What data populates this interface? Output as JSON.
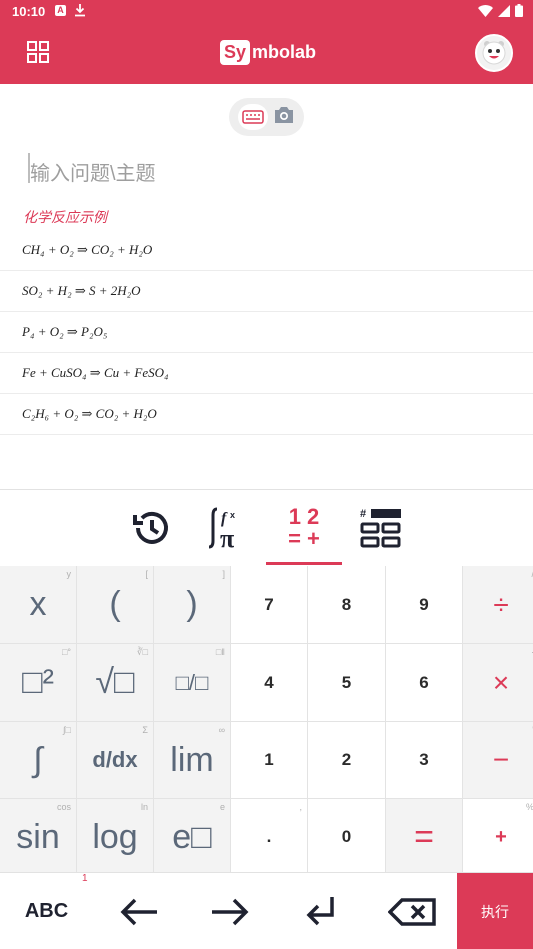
{
  "status_bar": {
    "time": "10:10",
    "notif_letter": "A"
  },
  "header": {
    "logo_highlight": "Sy",
    "logo_rest": "mbolab"
  },
  "input": {
    "placeholder": "输入问题\\主题"
  },
  "examples": {
    "title": "化学反应示例",
    "items": [
      "CH₄ + O₂ ⇒ CO₂ + H₂O",
      "SO₂ + H₂ ⇒ S + 2H₂O",
      "P₄ + O₂ ⇒ P₂O₅",
      "Fe + CuSO₄ ⇒ Cu + FeSO₄",
      "C₂H₆ + O₂ ⇒ CO₂ + H₂O"
    ]
  },
  "keyboard_tabs": {
    "numbers_top": "1 2",
    "numbers_bottom": "= +"
  },
  "keypad": {
    "row1": [
      {
        "label": "x",
        "hint": "y"
      },
      {
        "label": "(",
        "hint": "["
      },
      {
        "label": ")",
        "hint": "]"
      },
      {
        "label": "7",
        "hint": ""
      },
      {
        "label": "8",
        "hint": ""
      },
      {
        "label": "9",
        "hint": ""
      },
      {
        "label": "÷",
        "hint": "/"
      }
    ],
    "row2": [
      {
        "label": "□²",
        "hint": "□°"
      },
      {
        "label": "√□",
        "hint": "∛□"
      },
      {
        "label": "□/□",
        "hint": "□‖"
      },
      {
        "label": "4",
        "hint": ""
      },
      {
        "label": "5",
        "hint": ""
      },
      {
        "label": "6",
        "hint": ""
      },
      {
        "label": "×",
        "hint": "·"
      }
    ],
    "row3": [
      {
        "label": "∫",
        "hint": "∫□"
      },
      {
        "label": "d/dx",
        "hint": "Σ"
      },
      {
        "label": "lim",
        "hint": "∞"
      },
      {
        "label": "1",
        "hint": ""
      },
      {
        "label": "2",
        "hint": ""
      },
      {
        "label": "3",
        "hint": ""
      },
      {
        "label": "−",
        "hint": "'"
      }
    ],
    "row4": [
      {
        "label": "sin",
        "hint": "cos"
      },
      {
        "label": "log",
        "hint": "ln"
      },
      {
        "label": "e□",
        "hint": "e"
      },
      {
        "label": ".",
        "hint": ","
      },
      {
        "label": "0",
        "hint": ""
      },
      {
        "label": "=",
        "hint": ""
      },
      {
        "label": "+",
        "hint": "%"
      }
    ]
  },
  "bottom_bar": {
    "abc": "ABC",
    "badge": "1",
    "execute": "执行"
  },
  "colors": {
    "brand": "#dc3a57",
    "key_text": "#5b6879"
  }
}
